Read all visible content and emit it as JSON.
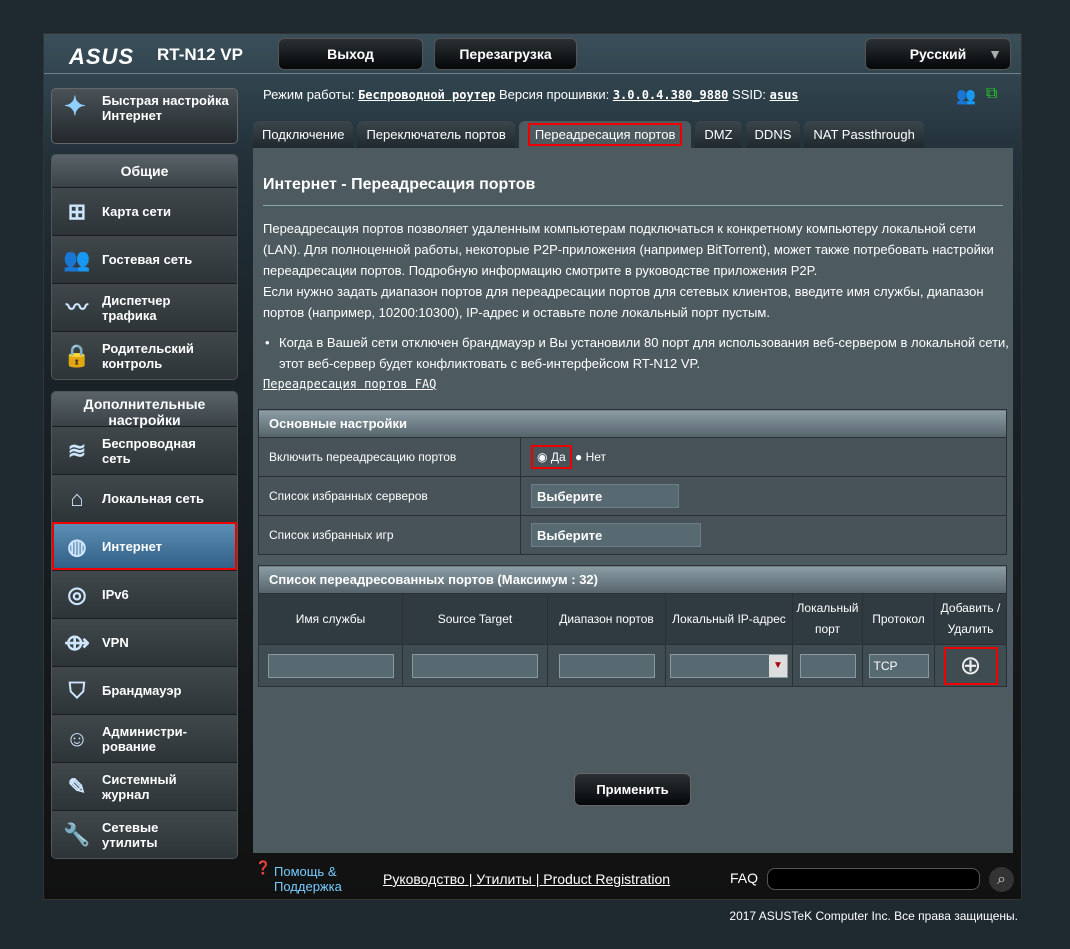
{
  "header": {
    "logo": "ASUS",
    "model": "RT-N12 VP",
    "logout": "Выход",
    "reboot": "Перезагрузка",
    "language": "Русский"
  },
  "quick_setup": "Быстрая настройка Интернет",
  "sidebar": {
    "general_title": "Общие",
    "general": [
      {
        "label": "Карта сети",
        "icon": "network-map-icon"
      },
      {
        "label": "Гостевая сеть",
        "icon": "guest-network-icon"
      },
      {
        "label": "Диспетчер трафика",
        "icon": "traffic-icon"
      },
      {
        "label": "Родительский контроль",
        "icon": "lock-icon"
      }
    ],
    "advanced_title": "Дополнительные настройки",
    "advanced": [
      {
        "label": "Беспроводная сеть",
        "icon": "wifi-icon"
      },
      {
        "label": "Локальная сеть",
        "icon": "home-icon"
      },
      {
        "label": "Интернет",
        "icon": "globe-icon",
        "selected": true
      },
      {
        "label": "IPv6",
        "icon": "ipv6-icon"
      },
      {
        "label": "VPN",
        "icon": "vpn-icon"
      },
      {
        "label": "Брандмауэр",
        "icon": "shield-icon"
      },
      {
        "label": "Администри-рование",
        "icon": "admin-icon"
      },
      {
        "label": "Системный журнал",
        "icon": "log-icon"
      },
      {
        "label": "Сетевые утилиты",
        "icon": "tools-icon"
      }
    ]
  },
  "info": {
    "mode_label": "Режим работы:",
    "mode": "Беспроводной роутер",
    "fw_label": "Версия прошивки:",
    "fw": "3.0.0.4.380_9880",
    "ssid_label": "SSID:",
    "ssid": "asus"
  },
  "tabs": [
    "Подключение",
    "Переключатель портов",
    "Переадресация портов",
    "DMZ",
    "DDNS",
    "NAT Passthrough"
  ],
  "page": {
    "title": "Интернет - Переадресация портов",
    "desc1": "Переадресация портов позволяет удаленным компьютерам подключаться к конкретному компьютеру локальной сети (LAN). Для полноценной работы, некоторые P2P-приложения (например BitTorrent), может также потребовать настройки переадресации портов. Подробную информацию смотрите в руководстве приложения P2P.",
    "desc2": "Если нужно задать диапазон портов для переадресации портов для сетевых клиентов, введите имя службы, диапазон портов (например, 10200:10300), IP-адрес и оставьте поле локальный порт пустым.",
    "bullet": "Когда в Вашей сети отключен брандмауэр и Вы установили 80 порт для использования веб-сервером в локальной сети, этот веб-сервер будет конфликтовать с веб-интерфейсом RT-N12 VP.",
    "faq": "Переадресация портов FAQ"
  },
  "basic": {
    "title": "Основные настройки",
    "enable_label": "Включить переадресацию портов",
    "yes": "Да",
    "no": "Нет",
    "selected": "Да",
    "servers_label": "Список избранных серверов",
    "servers_value": "Выберите",
    "games_label": "Список избранных игр",
    "games_value": "Выберите"
  },
  "list": {
    "title": "Список переадресованных портов (Максимум : 32)",
    "columns": [
      "Имя службы",
      "Source Target",
      "Диапазон портов",
      "Локальный IP-адрес",
      "Локальный порт",
      "Протокол",
      "Добавить / Удалить"
    ],
    "protocol": "TCP"
  },
  "apply": "Применить",
  "footer": {
    "help": "Помощь & Поддержка",
    "manual": "Руководство",
    "utils": "Утилиты",
    "reg": "Product Registration",
    "faq": "FAQ"
  },
  "copyright": "2017 ASUSTeK Computer Inc. Все права защищены."
}
